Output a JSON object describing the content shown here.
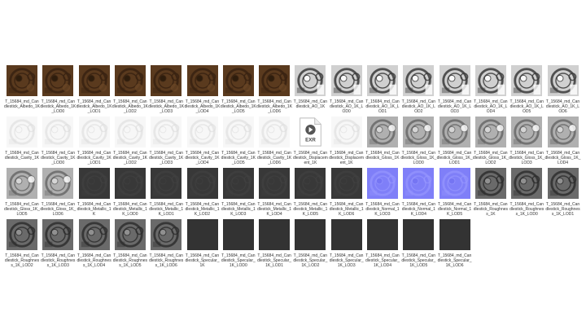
{
  "window": {
    "background": "#ffffff"
  },
  "colors": {
    "albedo_base": "#5a3a1e",
    "albedo_dark": "#3a2412",
    "ao_base": "#d0d0d0",
    "ao_dark": "#3a3a3a",
    "cavity_base": "#f7f7f7",
    "gloss_base": "#b0b0b0",
    "metallic_base": "#383838",
    "normal_base": "#7f7ff8",
    "roughness_base": "#6a6a6a",
    "specular_base": "#333333",
    "exr_icon": "#555555",
    "label_text": "#333333"
  },
  "files": [
    {
      "name": "T_15684_md_Candlestick_Albedo_1K",
      "type": "albedo"
    },
    {
      "name": "T_15684_md_Candlestick_Albedo_1K_LOD0",
      "type": "albedo"
    },
    {
      "name": "T_15684_md_Candlestick_Albedo_1K_LOD1",
      "type": "albedo"
    },
    {
      "name": "T_15684_md_Candlestick_Albedo_1K_LOD2",
      "type": "albedo"
    },
    {
      "name": "T_15684_md_Candlestick_Albedo_1K_LOD3",
      "type": "albedo"
    },
    {
      "name": "T_15684_md_Candlestick_Albedo_1K_LOD4",
      "type": "albedo"
    },
    {
      "name": "T_15684_md_Candlestick_Albedo_1K_LOD5",
      "type": "albedo"
    },
    {
      "name": "T_15684_md_Candlestick_Albedo_1K_LOD6",
      "type": "albedo"
    },
    {
      "name": "T_15684_md_Candlestick_AO_1K",
      "type": "ao"
    },
    {
      "name": "T_15684_md_Candlestick_AO_1K_LOD0",
      "type": "ao"
    },
    {
      "name": "T_15684_md_Candlestick_AO_1K_LOD1",
      "type": "ao"
    },
    {
      "name": "T_15684_md_Candlestick_AO_1K_LOD2",
      "type": "ao"
    },
    {
      "name": "T_15684_md_Candlestick_AO_1K_LOD3",
      "type": "ao"
    },
    {
      "name": "T_15684_md_Candlestick_AO_1K_LOD4",
      "type": "ao"
    },
    {
      "name": "T_15684_md_Candlestick_AO_1K_LOD5",
      "type": "ao"
    },
    {
      "name": "T_15684_md_Candlestick_AO_1K_LOD6",
      "type": "ao"
    },
    {
      "name": "T_15684_md_Candlestick_Cavity_1K",
      "type": "cavity"
    },
    {
      "name": "T_15684_md_Candlestick_Cavity_1K_LOD0",
      "type": "cavity"
    },
    {
      "name": "T_15684_md_Candlestick_Cavity_1K_LOD1",
      "type": "cavity"
    },
    {
      "name": "T_15684_md_Candlestick_Cavity_1K_LOD2",
      "type": "cavity"
    },
    {
      "name": "T_15684_md_Candlestick_Cavity_1K_LOD3",
      "type": "cavity"
    },
    {
      "name": "T_15684_md_Candlestick_Cavity_1K_LOD4",
      "type": "cavity"
    },
    {
      "name": "T_15684_md_Candlestick_Cavity_1K_LOD5",
      "type": "cavity"
    },
    {
      "name": "T_15684_md_Candlestick_Cavity_1K_LOD6",
      "type": "cavity"
    },
    {
      "name": "T_15684_md_Candlestick_Displacement_1K",
      "type": "exr",
      "badge": "EXR"
    },
    {
      "name": "T_15684_md_Candlestick_Displacement_1K",
      "type": "cavity"
    },
    {
      "name": "T_15684_md_Candlestick_Gloss_1K",
      "type": "gloss"
    },
    {
      "name": "T_15684_md_Candlestick_Gloss_1K_LOD0",
      "type": "gloss"
    },
    {
      "name": "T_15684_md_Candlestick_Gloss_1K_LOD1",
      "type": "gloss"
    },
    {
      "name": "T_15684_md_Candlestick_Gloss_1K_LOD2",
      "type": "gloss"
    },
    {
      "name": "T_15684_md_Candlestick_Gloss_1K_LOD3",
      "type": "gloss"
    },
    {
      "name": "T_15684_md_Candlestick_Gloss_1K_LOD4",
      "type": "gloss"
    },
    {
      "name": "T_15684_md_Candlestick_Gloss_1K_LOD5",
      "type": "gloss"
    },
    {
      "name": "T_15684_md_Candlestick_Gloss_1K_LOD6",
      "type": "gloss"
    },
    {
      "name": "T_15684_md_Candlestick_Metallic_1K",
      "type": "metallic"
    },
    {
      "name": "T_15684_md_Candlestick_Metallic_1K_LOD0",
      "type": "metallic"
    },
    {
      "name": "T_15684_md_Candlestick_Metallic_1K_LOD1",
      "type": "metallic"
    },
    {
      "name": "T_15684_md_Candlestick_Metallic_1K_LOD2",
      "type": "metallic"
    },
    {
      "name": "T_15684_md_Candlestick_Metallic_1K_LOD3",
      "type": "metallic"
    },
    {
      "name": "T_15684_md_Candlestick_Metallic_1K_LOD4",
      "type": "metallic"
    },
    {
      "name": "T_15684_md_Candlestick_Metallic_1K_LOD5",
      "type": "metallic"
    },
    {
      "name": "T_15684_md_Candlestick_Metallic_1K_LOD6",
      "type": "metallic"
    },
    {
      "name": "T_15684_md_Candlestick_Normal_1K_LOD3",
      "type": "normal"
    },
    {
      "name": "T_15684_md_Candlestick_Normal_1K_LOD4",
      "type": "normal"
    },
    {
      "name": "T_15684_md_Candlestick_Normal_1K_LOD5",
      "type": "normal"
    },
    {
      "name": "T_15684_md_Candlestick_Roughness_1K",
      "type": "roughness"
    },
    {
      "name": "T_15684_md_Candlestick_Roughness_1K_LOD0",
      "type": "roughness"
    },
    {
      "name": "T_15684_md_Candlestick_Roughness_1K_LOD1",
      "type": "roughness"
    },
    {
      "name": "T_15684_md_Candlestick_Roughness_1K_LOD2",
      "type": "roughness"
    },
    {
      "name": "T_15684_md_Candlestick_Roughness_1K_LOD3",
      "type": "roughness"
    },
    {
      "name": "T_15684_md_Candlestick_Roughness_1K_LOD4",
      "type": "roughness"
    },
    {
      "name": "T_15684_md_Candlestick_Roughness_1K_LOD5",
      "type": "roughness"
    },
    {
      "name": "T_15684_md_Candlestick_Roughness_1K_LOD6",
      "type": "roughness"
    },
    {
      "name": "T_15684_md_Candlestick_Specular_1K",
      "type": "specular"
    },
    {
      "name": "T_15684_md_Candlestick_Specular_1K_LOD0",
      "type": "specular"
    },
    {
      "name": "T_15684_md_Candlestick_Specular_1K_LOD1",
      "type": "specular"
    },
    {
      "name": "T_15684_md_Candlestick_Specular_1K_LOD2",
      "type": "specular"
    },
    {
      "name": "T_15684_md_Candlestick_Specular_1K_LOD3",
      "type": "specular"
    },
    {
      "name": "T_15684_md_Candlestick_Specular_1K_LOD4",
      "type": "specular"
    },
    {
      "name": "T_15684_md_Candlestick_Specular_1K_LOD5",
      "type": "specular"
    },
    {
      "name": "T_15684_md_Candlestick_Specular_1K_LOD6",
      "type": "specular"
    }
  ]
}
